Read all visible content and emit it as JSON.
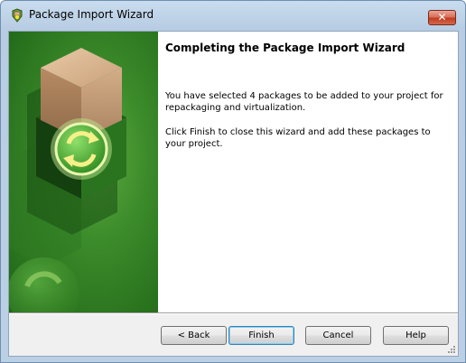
{
  "window": {
    "title": "Package Import Wizard",
    "close_glyph": "✕",
    "icon": "wizard-app-icon"
  },
  "content": {
    "heading": "Completing the Package Import Wizard",
    "paragraph1": "You have selected 4 packages to be added to your project for repackaging and virtualization.",
    "paragraph2": "Click Finish to close this wizard and add these packages to your project."
  },
  "buttons": {
    "back": "< Back",
    "finish": "Finish",
    "cancel": "Cancel",
    "help": "Help"
  },
  "colors": {
    "side_panel_green": "#3b8a2a",
    "title_bar": "#c9dcef",
    "close_red": "#c23d20"
  }
}
